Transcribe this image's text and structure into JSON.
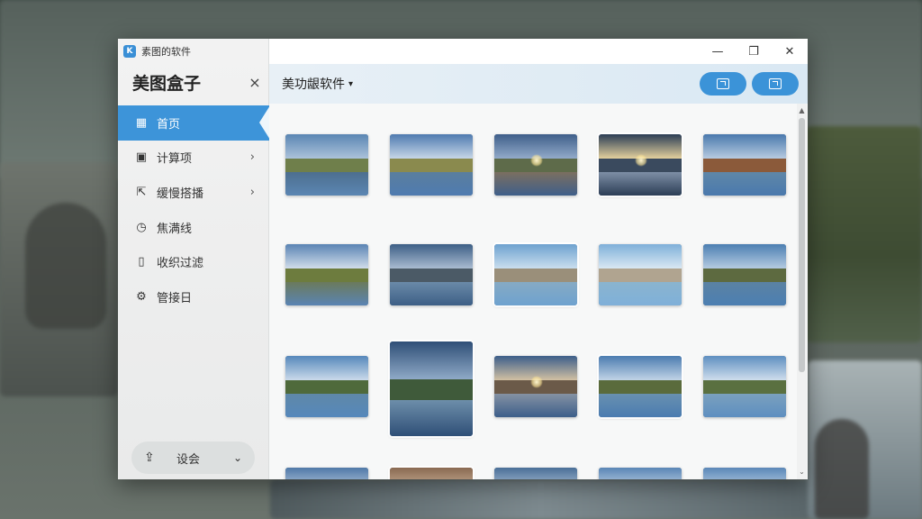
{
  "app": {
    "window_title": "素图的软件",
    "icon_glyph": "K"
  },
  "sidebar": {
    "title": "美图盒子",
    "close_glyph": "×",
    "items": [
      {
        "label": "首页",
        "icon": "grid-icon",
        "glyph": "▦",
        "active": true,
        "has_chevron": false
      },
      {
        "label": "计算项",
        "icon": "calendar-icon",
        "glyph": "▣",
        "active": false,
        "has_chevron": true
      },
      {
        "label": "缓慢搭播",
        "icon": "export-icon",
        "glyph": "⇱",
        "active": false,
        "has_chevron": true
      },
      {
        "label": "焦满线",
        "icon": "clock-icon",
        "glyph": "◷",
        "active": false,
        "has_chevron": false
      },
      {
        "label": "收织过滤",
        "icon": "document-icon",
        "glyph": "▯",
        "active": false,
        "has_chevron": false
      },
      {
        "label": "管接日",
        "icon": "gear-icon",
        "glyph": "⚙",
        "active": false,
        "has_chevron": false
      }
    ],
    "chevron_glyph": "›",
    "settings": {
      "label": "设会",
      "icon_glyph": "⇪",
      "chevron_glyph": "⌄"
    }
  },
  "titlebar": {
    "minimize": "—",
    "maximize": "❐",
    "close": "✕"
  },
  "toolbar": {
    "category_label": "美功龈软件",
    "caret": "▾"
  },
  "scrollbar": {
    "up": "▲",
    "down": "⌄"
  },
  "colors": {
    "accent": "#3d94d9",
    "toolbar_bg": "#d9e8f3"
  },
  "thumbnails": [
    {
      "scene": "lake-path"
    },
    {
      "scene": "meadow-lake"
    },
    {
      "scene": "road-sunset"
    },
    {
      "scene": "bridge-sunburst"
    },
    {
      "scene": "lake-cliffs"
    },
    {
      "scene": "field-clouds"
    },
    {
      "scene": "coast-reflection"
    },
    {
      "scene": "seaside-walk"
    },
    {
      "scene": "woman-pier"
    },
    {
      "scene": "lake-hills"
    },
    {
      "scene": "river-clouds"
    },
    {
      "scene": "lake-tall"
    },
    {
      "scene": "road-horizon"
    },
    {
      "scene": "island-lake"
    },
    {
      "scene": "marsh-river"
    },
    {
      "scene": "lake-bottom-1"
    },
    {
      "scene": "cliff-bottom"
    },
    {
      "scene": "lake-bottom-2"
    },
    {
      "scene": "cloud-bottom"
    },
    {
      "scene": "shore-bottom"
    }
  ]
}
